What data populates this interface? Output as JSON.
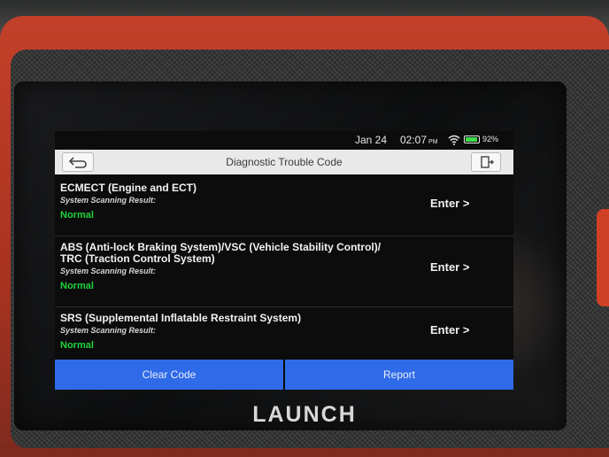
{
  "status_bar": {
    "date": "Jan 24",
    "time": "02:07",
    "ampm": "PM",
    "battery": "92%"
  },
  "header": {
    "title": "Diagnostic Trouble Code"
  },
  "systems": [
    {
      "name_line1": "ECMECT (Engine and ECT)",
      "name_line2": "",
      "result_label": "System Scanning Result:",
      "status": "Normal",
      "action": "Enter >"
    },
    {
      "name_line1": "ABS (Anti-lock Braking System)/VSC (Vehicle Stability Control)/",
      "name_line2": "TRC (Traction Control System)",
      "result_label": "System Scanning Result:",
      "status": "Normal",
      "action": "Enter >"
    },
    {
      "name_line1": "SRS (Supplemental Inflatable Restraint System)",
      "name_line2": "",
      "result_label": "System Scanning Result:",
      "status": "Normal",
      "action": "Enter >"
    }
  ],
  "footer": {
    "clear_code": "Clear Code",
    "report": "Report"
  },
  "device": {
    "brand": "LAUNCH"
  },
  "icons": {
    "back": "back-arrow-icon",
    "exit": "exit-icon",
    "wifi": "wifi-icon",
    "battery": "battery-icon"
  },
  "colors": {
    "status_ok": "#1fd23c",
    "button_blue": "#2f6be8",
    "device_red": "#c2402a"
  }
}
